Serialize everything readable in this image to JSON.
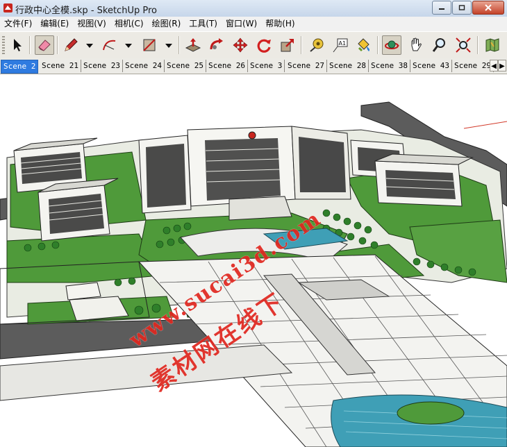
{
  "window": {
    "title": "行政中心全模.skp - SketchUp Pro"
  },
  "menu": [
    "文件(F)",
    "编辑(E)",
    "视图(V)",
    "相机(C)",
    "绘图(R)",
    "工具(T)",
    "窗口(W)",
    "帮助(H)"
  ],
  "toolbar": {
    "tools": [
      {
        "name": "select-icon"
      },
      {
        "name": "eraser-icon",
        "active": true
      },
      {
        "name": "pencil-icon"
      },
      {
        "name": "arc-icon"
      },
      {
        "name": "rectangle-icon"
      },
      {
        "name": "push-pull-icon"
      },
      {
        "name": "follow-me-icon"
      },
      {
        "name": "move-icon"
      },
      {
        "name": "rotate-icon"
      },
      {
        "name": "scale-icon"
      },
      {
        "name": "tape-measure-icon"
      },
      {
        "name": "text-icon"
      },
      {
        "name": "paint-bucket-icon"
      },
      {
        "name": "orbit-icon",
        "active": true
      },
      {
        "name": "pan-icon"
      },
      {
        "name": "zoom-icon"
      },
      {
        "name": "zoom-extents-icon"
      },
      {
        "name": "map-icon"
      }
    ],
    "text_tool_label": "A1"
  },
  "scenes": {
    "tabs": [
      "Scene 2",
      "Scene 21",
      "Scene 23",
      "Scene 24",
      "Scene 25",
      "Scene 26",
      "Scene 3",
      "Scene 27",
      "Scene 28",
      "Scene 38",
      "Scene 43",
      "Scene 29"
    ],
    "active": "Scene 2"
  },
  "viewport": {
    "watermark_line1": "www.sucai3d.com",
    "watermark_line2": "素材网在线下"
  },
  "colors": {
    "active_tab": "#2f7be0",
    "watermark": "#e0271f",
    "lawn": "#4f9a3a",
    "road": "#5c5c5c",
    "water": "#3f9fb6"
  }
}
